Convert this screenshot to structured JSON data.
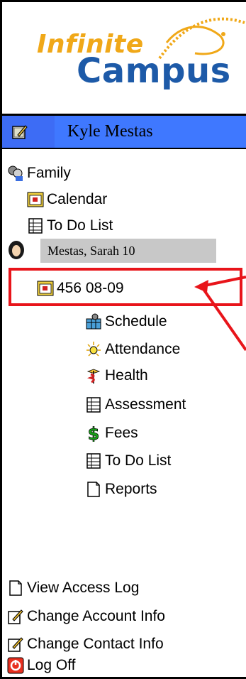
{
  "logo": {
    "line1": "Infinite",
    "line2": "Campus"
  },
  "user": {
    "name": "Kyle Mestas"
  },
  "nav": {
    "family": "Family",
    "calendar": "Calendar",
    "todo_family": "To Do List",
    "student_banner": "Mestas, Sarah 10",
    "school_year": "456 08-09",
    "schedule": "Schedule",
    "attendance": "Attendance",
    "health": "Health",
    "assessment": "Assessment",
    "fees": "Fees",
    "todo_student": "To Do List",
    "reports": "Reports"
  },
  "footer": {
    "access_log": "View Access Log",
    "change_account": "Change Account Info",
    "change_contact": "Change Contact Info",
    "log_off": "Log Off"
  },
  "colors": {
    "header_bar": "#3f78ff",
    "highlight": "#e8141a",
    "banner": "#c8c8c8",
    "logo_orange": "#f0a818",
    "logo_blue": "#1d5aa8"
  }
}
